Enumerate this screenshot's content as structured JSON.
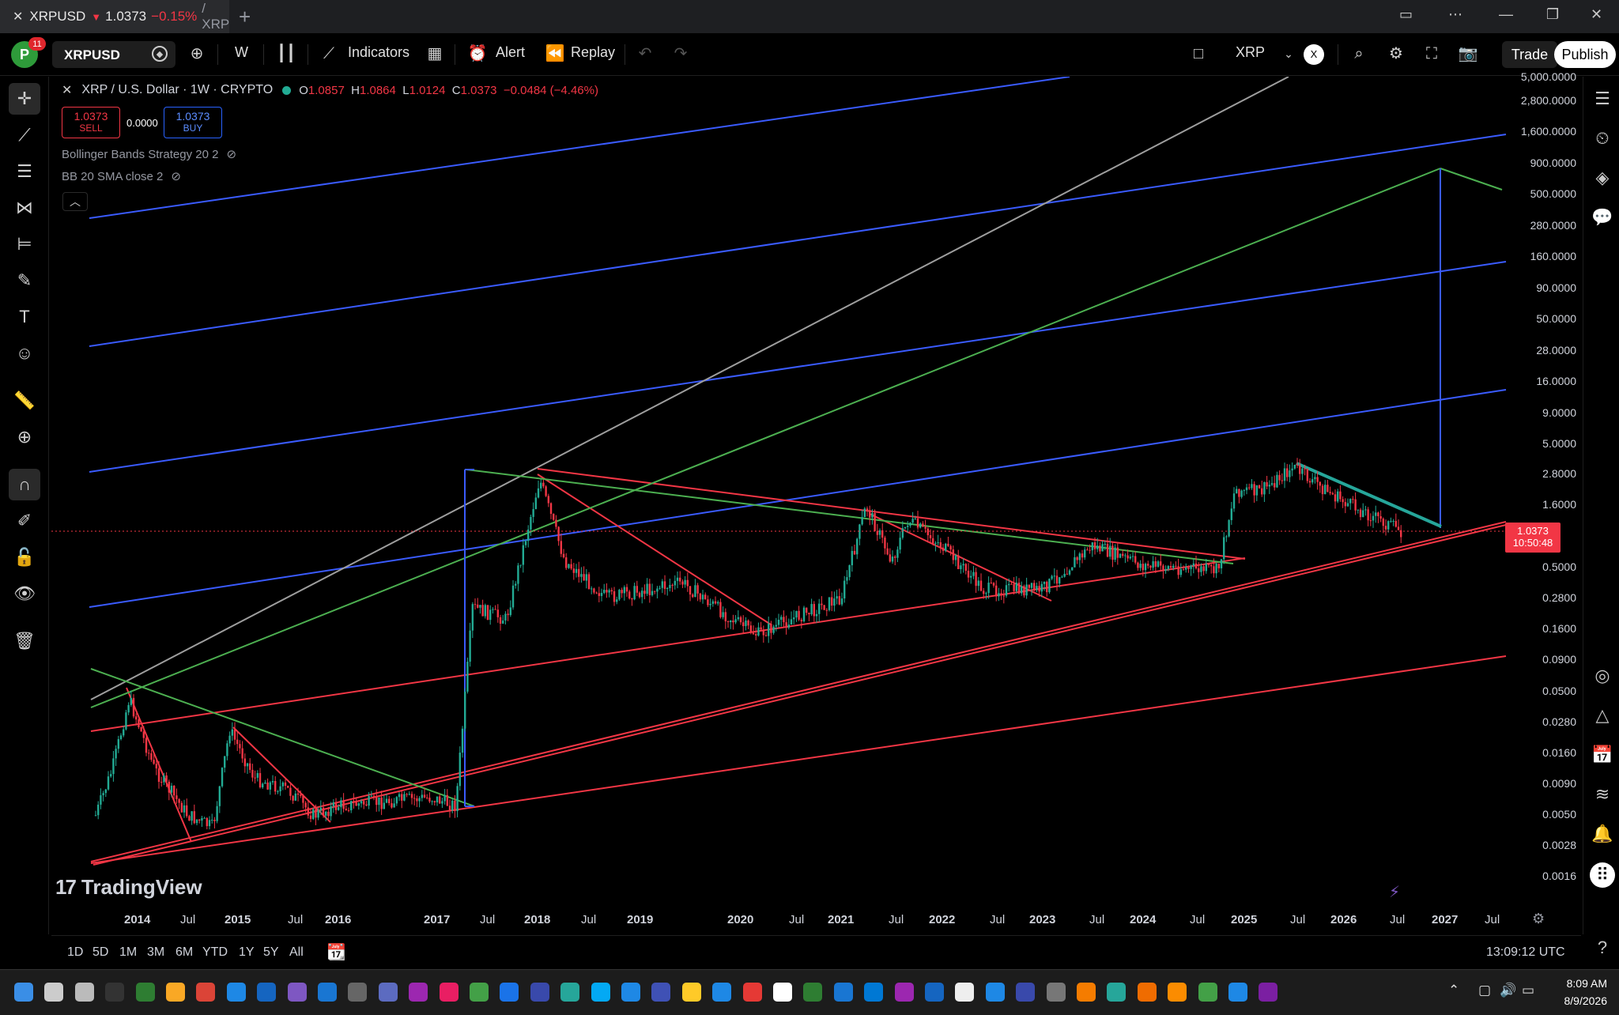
{
  "browser": {
    "tab_symbol": "XRPUSD",
    "tab_price": "1.0373",
    "tab_change": "−0.15%",
    "tab_suffix": "/ XRP",
    "new_tab": "+"
  },
  "toolbar": {
    "avatar_letter": "P",
    "notification_count": "11",
    "symbol": "XRPUSD",
    "interval": "W",
    "indicators_label": "Indicators",
    "alert_label": "Alert",
    "replay_label": "Replay",
    "layout_name": "XRP",
    "layout_badge": "X",
    "trade_label": "Trade",
    "publish_label": "Publish"
  },
  "legend": {
    "title": "XRP / U.S. Dollar · 1W · CRYPTO",
    "o_label": "O",
    "o": "1.0857",
    "h_label": "H",
    "h": "1.0864",
    "l_label": "L",
    "l": "1.0124",
    "c_label": "C",
    "c": "1.0373",
    "change": "−0.0484 (−4.46%)"
  },
  "order": {
    "sell_price": "1.0373",
    "sell_label": "SELL",
    "spread": "0.0000",
    "buy_price": "1.0373",
    "buy_label": "BUY"
  },
  "indicators": [
    {
      "label": "Bollinger Bands Strategy 20 2"
    },
    {
      "label": "BB 20 SMA close 2"
    }
  ],
  "price_tag": {
    "price": "1.0373",
    "countdown": "10:50:48"
  },
  "logo": "TradingView",
  "y_axis_labels": [
    "5,000.0000",
    "2,800.0000",
    "1,600.0000",
    "900.0000",
    "500.0000",
    "280.0000",
    "160.0000",
    "90.0000",
    "50.0000",
    "28.0000",
    "16.0000",
    "9.0000",
    "5.0000",
    "2.8000",
    "1.6000",
    "0.5000",
    "0.2800",
    "0.1600",
    "0.0900",
    "0.0500",
    "0.0280",
    "0.0160",
    "0.0090",
    "0.0050",
    "0.0028",
    "0.0016"
  ],
  "x_axis_labels": [
    {
      "label": "2014",
      "year": true
    },
    {
      "label": "Jul",
      "year": false
    },
    {
      "label": "2015",
      "year": true
    },
    {
      "label": "Jul",
      "year": false
    },
    {
      "label": "2016",
      "year": true
    },
    {
      "label": "2017",
      "year": true
    },
    {
      "label": "Jul",
      "year": false
    },
    {
      "label": "2018",
      "year": true
    },
    {
      "label": "Jul",
      "year": false
    },
    {
      "label": "2019",
      "year": true
    },
    {
      "label": "2020",
      "year": true
    },
    {
      "label": "Jul",
      "year": false
    },
    {
      "label": "2021",
      "year": true
    },
    {
      "label": "Jul",
      "year": false
    },
    {
      "label": "2022",
      "year": true
    },
    {
      "label": "Jul",
      "year": false
    },
    {
      "label": "2023",
      "year": true
    },
    {
      "label": "Jul",
      "year": false
    },
    {
      "label": "2024",
      "year": true
    },
    {
      "label": "Jul",
      "year": false
    },
    {
      "label": "2025",
      "year": true
    },
    {
      "label": "Jul",
      "year": false
    },
    {
      "label": "2026",
      "year": true
    },
    {
      "label": "Jul",
      "year": false
    },
    {
      "label": "2027",
      "year": true
    },
    {
      "label": "Jul",
      "year": false
    }
  ],
  "ranges": [
    "1D",
    "5D",
    "1M",
    "3M",
    "6M",
    "YTD",
    "1Y",
    "5Y",
    "All"
  ],
  "utc_time": "13:09:12 UTC",
  "clock": {
    "time": "8:09 AM",
    "date": "8/9/2026"
  },
  "colors": {
    "down": "#f23645",
    "up": "#22ab94",
    "blue_line": "#3a5bff",
    "red_line": "#f23645",
    "green_line": "#4caf50",
    "grey_line": "#9e9e9e",
    "teal_line": "#26a69a"
  },
  "chart_data": {
    "type": "candlestick",
    "scale": "log",
    "symbol": "XRP / U.S. Dollar",
    "interval": "1W",
    "last_close": 1.0373,
    "price_path": [
      {
        "date": "2013-08",
        "price": 0.005
      },
      {
        "date": "2013-10",
        "price": 0.012
      },
      {
        "date": "2013-12",
        "price": 0.045
      },
      {
        "date": "2014-03",
        "price": 0.012
      },
      {
        "date": "2014-07",
        "price": 0.005
      },
      {
        "date": "2014-10",
        "price": 0.004
      },
      {
        "date": "2014-12",
        "price": 0.025
      },
      {
        "date": "2015-03",
        "price": 0.01
      },
      {
        "date": "2015-07",
        "price": 0.008
      },
      {
        "date": "2015-10",
        "price": 0.005
      },
      {
        "date": "2016-01",
        "price": 0.006
      },
      {
        "date": "2016-07",
        "price": 0.0065
      },
      {
        "date": "2016-12",
        "price": 0.007
      },
      {
        "date": "2017-03",
        "price": 0.006
      },
      {
        "date": "2017-05",
        "price": 0.25
      },
      {
        "date": "2017-09",
        "price": 0.2
      },
      {
        "date": "2018-01",
        "price": 2.8
      },
      {
        "date": "2018-04",
        "price": 0.6
      },
      {
        "date": "2018-09",
        "price": 0.3
      },
      {
        "date": "2019-06",
        "price": 0.4
      },
      {
        "date": "2019-12",
        "price": 0.2
      },
      {
        "date": "2020-03",
        "price": 0.15
      },
      {
        "date": "2020-07",
        "price": 0.2
      },
      {
        "date": "2021-01",
        "price": 0.3
      },
      {
        "date": "2021-04",
        "price": 1.7
      },
      {
        "date": "2021-07",
        "price": 0.6
      },
      {
        "date": "2021-09",
        "price": 1.3
      },
      {
        "date": "2022-01",
        "price": 0.8
      },
      {
        "date": "2022-06",
        "price": 0.35
      },
      {
        "date": "2023-01",
        "price": 0.35
      },
      {
        "date": "2023-07",
        "price": 0.8
      },
      {
        "date": "2024-01",
        "price": 0.55
      },
      {
        "date": "2024-10",
        "price": 0.5
      },
      {
        "date": "2024-12",
        "price": 2.3
      },
      {
        "date": "2025-03",
        "price": 2.2
      },
      {
        "date": "2025-07",
        "price": 3.5
      },
      {
        "date": "2025-12",
        "price": 2.0
      },
      {
        "date": "2026-08",
        "price": 1.0373
      }
    ]
  }
}
